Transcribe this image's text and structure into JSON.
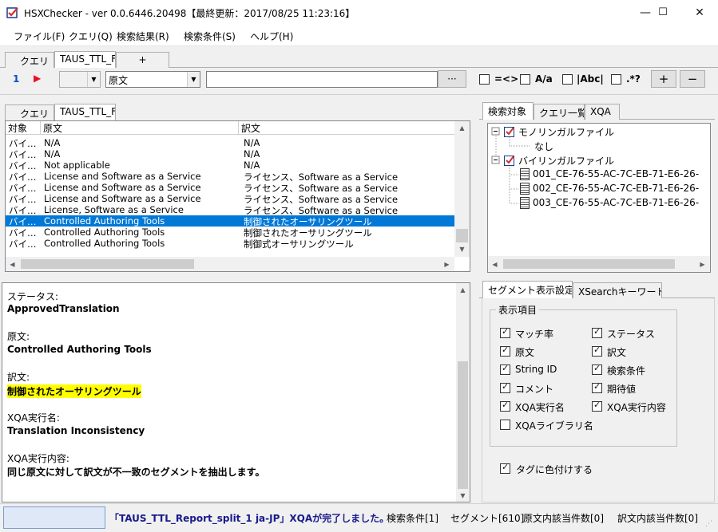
{
  "window": {
    "title": "HSXChecker - ver 0.0.6446.20498【最終更新：2017/08/25 11:23:16】",
    "minimize": "—",
    "maximize": "☐",
    "close": "✕"
  },
  "menu": [
    "ファイル(F)",
    "クエリ(Q)",
    "検索結果(R)",
    "検索条件(S)",
    "ヘルプ(H)"
  ],
  "query_tabs": {
    "tab1": "クエリ",
    "tab2": "TAUS_TTL_F",
    "add": "+"
  },
  "query_row": {
    "number": "1",
    "run_icon": "▶",
    "scope_value": "",
    "target_value": "原文",
    "search_value": "",
    "browse_label": "···",
    "opt_regex_eq": "=<>",
    "opt_case": "A/a",
    "opt_word": "|Abc|",
    "opt_regex": ".*?",
    "add_label": "+",
    "remove_label": "−"
  },
  "results": {
    "tabs": {
      "tab1": "クエリ",
      "tab2": "TAUS_TTL_F"
    },
    "columns": {
      "target": "対象",
      "source": "原文",
      "translation": "訳文"
    },
    "rows": [
      {
        "target": "バイ…",
        "source": "N/A",
        "translation": "N/A"
      },
      {
        "target": "バイ…",
        "source": "N/A",
        "translation": "N/A"
      },
      {
        "target": "バイ…",
        "source": "Not applicable",
        "translation": "N/A"
      },
      {
        "target": "バイ…",
        "source": "License and Software as a Service",
        "translation": "ライセンス、Software as a Service"
      },
      {
        "target": "バイ…",
        "source": "License and Software as a Service",
        "translation": "ライセンス、Software as a Service"
      },
      {
        "target": "バイ…",
        "source": "License and Software as a Service",
        "translation": "ライセンス、Software as a Service"
      },
      {
        "target": "バイ…",
        "source": "License, Software as a Service",
        "translation": "ライセンス、Software as a Service"
      },
      {
        "target": "バイ…",
        "source": "Controlled Authoring Tools",
        "translation": "制御されたオーサリングツール"
      },
      {
        "target": "バイ…",
        "source": "Controlled Authoring Tools",
        "translation": "制御されたオーサリングツール"
      },
      {
        "target": "バイ…",
        "source": "Controlled Authoring Tools",
        "translation": "制御式オーサリングツール"
      }
    ],
    "selected_index": 7
  },
  "right_tabs": {
    "search_target": "検索対象",
    "query_list": "クエリ一覧",
    "xqa": "XQA"
  },
  "tree": {
    "mono": "モノリンガルファイル",
    "mono_none": "なし",
    "bi": "バイリンガルファイル",
    "files": [
      "001_CE-76-55-AC-7C-EB-71-E6-26-",
      "002_CE-76-55-AC-7C-EB-71-E6-26-",
      "003_CE-76-55-AC-7C-EB-71-E6-26-"
    ]
  },
  "detail": {
    "status_label": "ステータス:",
    "status_value": "ApprovedTranslation",
    "source_label": "原文:",
    "source_value": "Controlled Authoring Tools",
    "trans_label": "訳文:",
    "trans_value": "制御されたオーサリングツール",
    "xqa_name_label": "XQA実行名:",
    "xqa_name_value": "Translation Inconsistency",
    "xqa_content_label": "XQA実行内容:",
    "xqa_content_value": "同じ原文に対して訳文が不一致のセグメントを抽出します。"
  },
  "segment_panel": {
    "tab1": "セグメント表示設定",
    "tab2": "XSearchキーワード",
    "group_title": "表示項目",
    "items": [
      {
        "label": "マッチ率",
        "checked": true
      },
      {
        "label": "ステータス",
        "checked": true
      },
      {
        "label": "原文",
        "checked": true
      },
      {
        "label": "訳文",
        "checked": true
      },
      {
        "label": "String ID",
        "checked": true
      },
      {
        "label": "検索条件",
        "checked": true
      },
      {
        "label": "コメント",
        "checked": true
      },
      {
        "label": "期待値",
        "checked": true
      },
      {
        "label": "XQA実行名",
        "checked": true
      },
      {
        "label": "XQA実行内容",
        "checked": true
      },
      {
        "label": "XQAライブラリ名",
        "checked": false
      }
    ],
    "color_tags": {
      "label": "タグに色付けする",
      "checked": true
    }
  },
  "status_bar": {
    "message": "「TAUS_TTL_Report_split_1 ja-JP」XQAが完了しました。",
    "search_conditions": "検索条件[1]",
    "segments": "セグメント[610]",
    "source_hits": "原文内該当件数[0]",
    "trans_hits": "訳文内該当件数[0]"
  },
  "colors": {
    "selection": "#0078d7",
    "highlight": "#ffff00",
    "run_icon": "#e81123",
    "status_text": "#1a1a8c"
  }
}
